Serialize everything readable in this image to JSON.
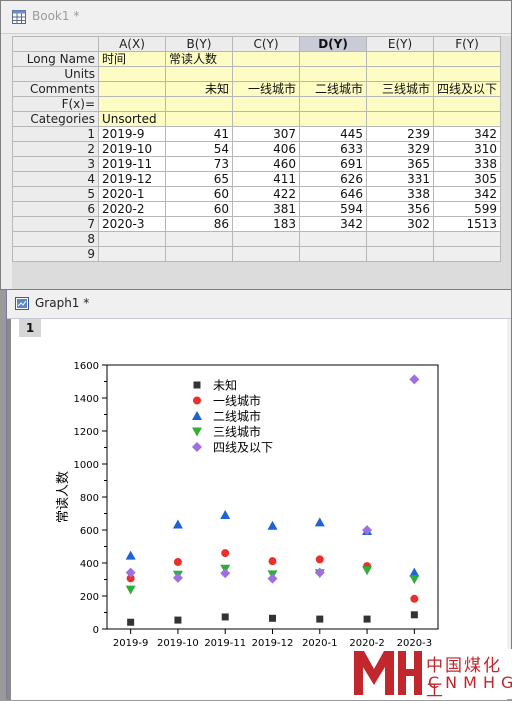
{
  "book": {
    "title": "Book1 *",
    "columns": [
      "A(X)",
      "B(Y)",
      "C(Y)",
      "D(Y)",
      "E(Y)",
      "F(Y)"
    ],
    "meta_rows": [
      {
        "label": "Long Name",
        "cells": [
          "时间",
          "常读人数",
          "",
          "",
          "",
          ""
        ]
      },
      {
        "label": "Units",
        "cells": [
          "",
          "",
          "",
          "",
          "",
          ""
        ]
      },
      {
        "label": "Comments",
        "cells": [
          "",
          "未知",
          "一线城市",
          "二线城市",
          "三线城市",
          "四线及以下"
        ]
      },
      {
        "label": "F(x)=",
        "cells": [
          "",
          "",
          "",
          "",
          "",
          ""
        ]
      },
      {
        "label": "Categories",
        "cells": [
          "Unsorted",
          "",
          "",
          "",
          "",
          ""
        ]
      }
    ],
    "rows": [
      {
        "n": "1",
        "cells": [
          "2019-9",
          "41",
          "307",
          "445",
          "239",
          "342"
        ]
      },
      {
        "n": "2",
        "cells": [
          "2019-10",
          "54",
          "406",
          "633",
          "329",
          "310"
        ]
      },
      {
        "n": "3",
        "cells": [
          "2019-11",
          "73",
          "460",
          "691",
          "365",
          "338"
        ]
      },
      {
        "n": "4",
        "cells": [
          "2019-12",
          "65",
          "411",
          "626",
          "331",
          "305"
        ]
      },
      {
        "n": "5",
        "cells": [
          "2020-1",
          "60",
          "422",
          "646",
          "338",
          "342"
        ]
      },
      {
        "n": "6",
        "cells": [
          "2020-2",
          "60",
          "381",
          "594",
          "356",
          "599"
        ]
      },
      {
        "n": "7",
        "cells": [
          "2020-3",
          "86",
          "183",
          "342",
          "302",
          "1513"
        ]
      },
      {
        "n": "8",
        "cells": [
          "",
          "",
          "",
          "",
          "",
          ""
        ]
      },
      {
        "n": "9",
        "cells": [
          "",
          "",
          "",
          "",
          "",
          ""
        ]
      }
    ]
  },
  "graph": {
    "title": "Graph1 *",
    "layer_label": "1"
  },
  "watermark": {
    "cn": "中国煤化工",
    "en": "CNMHG"
  },
  "chart_data": {
    "type": "scatter",
    "categories": [
      "2019-9",
      "2019-10",
      "2019-11",
      "2019-12",
      "2020-1",
      "2020-2",
      "2020-3"
    ],
    "ylabel": "常读人数",
    "xlabel": "",
    "ylim": [
      0,
      1600
    ],
    "yticks": [
      0,
      200,
      400,
      600,
      800,
      1000,
      1200,
      1400,
      1600
    ],
    "grid": false,
    "legend_position": "top-left",
    "series": [
      {
        "name": "未知",
        "marker": "square",
        "color": "#333333",
        "values": [
          41,
          54,
          73,
          65,
          60,
          60,
          86
        ]
      },
      {
        "name": "一线城市",
        "marker": "circle",
        "color": "#e8312b",
        "values": [
          307,
          406,
          460,
          411,
          422,
          381,
          183
        ]
      },
      {
        "name": "二线城市",
        "marker": "triangle-up",
        "color": "#1e62d6",
        "values": [
          445,
          633,
          691,
          626,
          646,
          594,
          342
        ]
      },
      {
        "name": "三线城市",
        "marker": "triangle-down",
        "color": "#2fae3b",
        "values": [
          239,
          329,
          365,
          331,
          338,
          356,
          302
        ]
      },
      {
        "name": "四线及以下",
        "marker": "diamond",
        "color": "#9e6fe0",
        "values": [
          342,
          310,
          338,
          305,
          342,
          599,
          1513
        ]
      }
    ]
  }
}
